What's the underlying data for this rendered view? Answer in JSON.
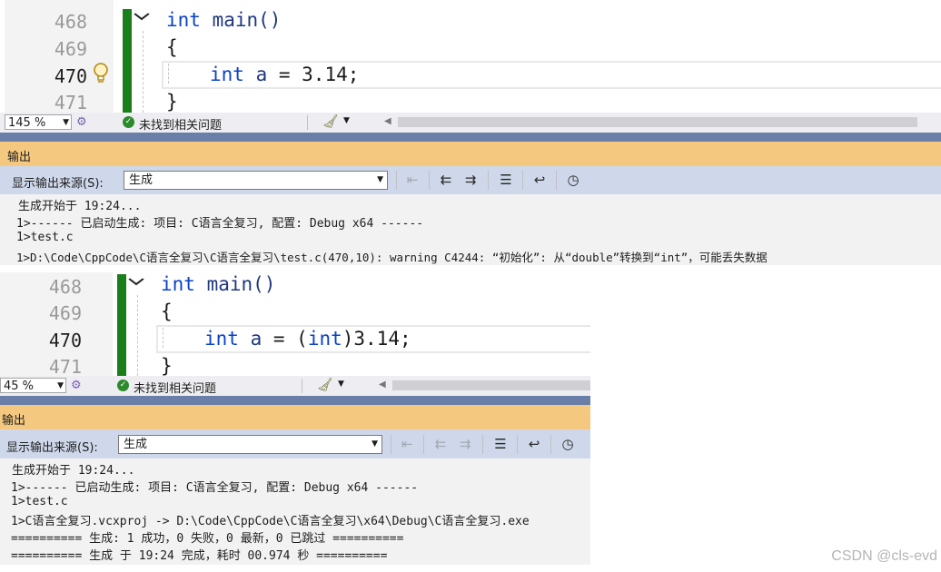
{
  "top_panel": {
    "editor": {
      "line_numbers": [
        "468",
        "469",
        "470",
        "471"
      ],
      "current_line": "470",
      "code": {
        "l468_kw": "int",
        "l468_rest": " main()",
        "l469": "{",
        "l470_kw": "int",
        "l470_id": " a",
        "l470_rest": " = 3.14;",
        "l471": "}"
      },
      "lightbulb_icon": "lightbulb-icon",
      "fold_icon": "chevron-down-icon"
    },
    "status": {
      "zoom": "145 %",
      "issues_text": "未找到相关问题",
      "ok_icon": "check-circle-icon",
      "cleanup_icon": "broom-icon"
    },
    "output": {
      "title": "输出",
      "source_label": "显示输出来源(S):",
      "source_value": "生成",
      "lines": [
        "生成开始于 19:24...",
        "1>------ 已启动生成: 项目: C语言全复习, 配置: Debug x64 ------",
        "1>test.c",
        "1>D:\\Code\\CppCode\\C语言全复习\\C语言全复习\\test.c(470,10): warning C4244: “初始化”: 从“double”转换到“int”，可能丢失数据"
      ]
    }
  },
  "bottom_panel": {
    "editor": {
      "line_numbers": [
        "468",
        "469",
        "470",
        "471"
      ],
      "current_line": "470",
      "code": {
        "l468_kw": "int",
        "l468_rest": " main()",
        "l469": "{",
        "l470_kw": "int",
        "l470_id": " a",
        "l470_eq": " = (",
        "l470_kw2": "int",
        "l470_rest": ")3.14;",
        "l471": "}"
      }
    },
    "status": {
      "zoom": "45 %",
      "issues_text": "未找到相关问题"
    },
    "output": {
      "title": "输出",
      "source_label": "显示输出来源(S):",
      "source_value": "生成",
      "lines": [
        "生成开始于 19:24...",
        "1>------ 已启动生成: 项目: C语言全复习, 配置: Debug x64 ------",
        "1>test.c",
        "1>C语言全复习.vcxproj -> D:\\Code\\CppCode\\C语言全复习\\x64\\Debug\\C语言全复习.exe",
        "========== 生成: 1 成功，0 失败，0 最新，0 已跳过 ==========",
        "========== 生成 于 19:24 完成，耗时 00.974 秒 =========="
      ]
    }
  },
  "toolbar_icons": [
    "find-message-icon",
    "previous-message-icon",
    "next-message-icon",
    "clear-all-icon",
    "word-wrap-icon",
    "clock-icon"
  ],
  "watermark": "CSDN @cls-evd"
}
